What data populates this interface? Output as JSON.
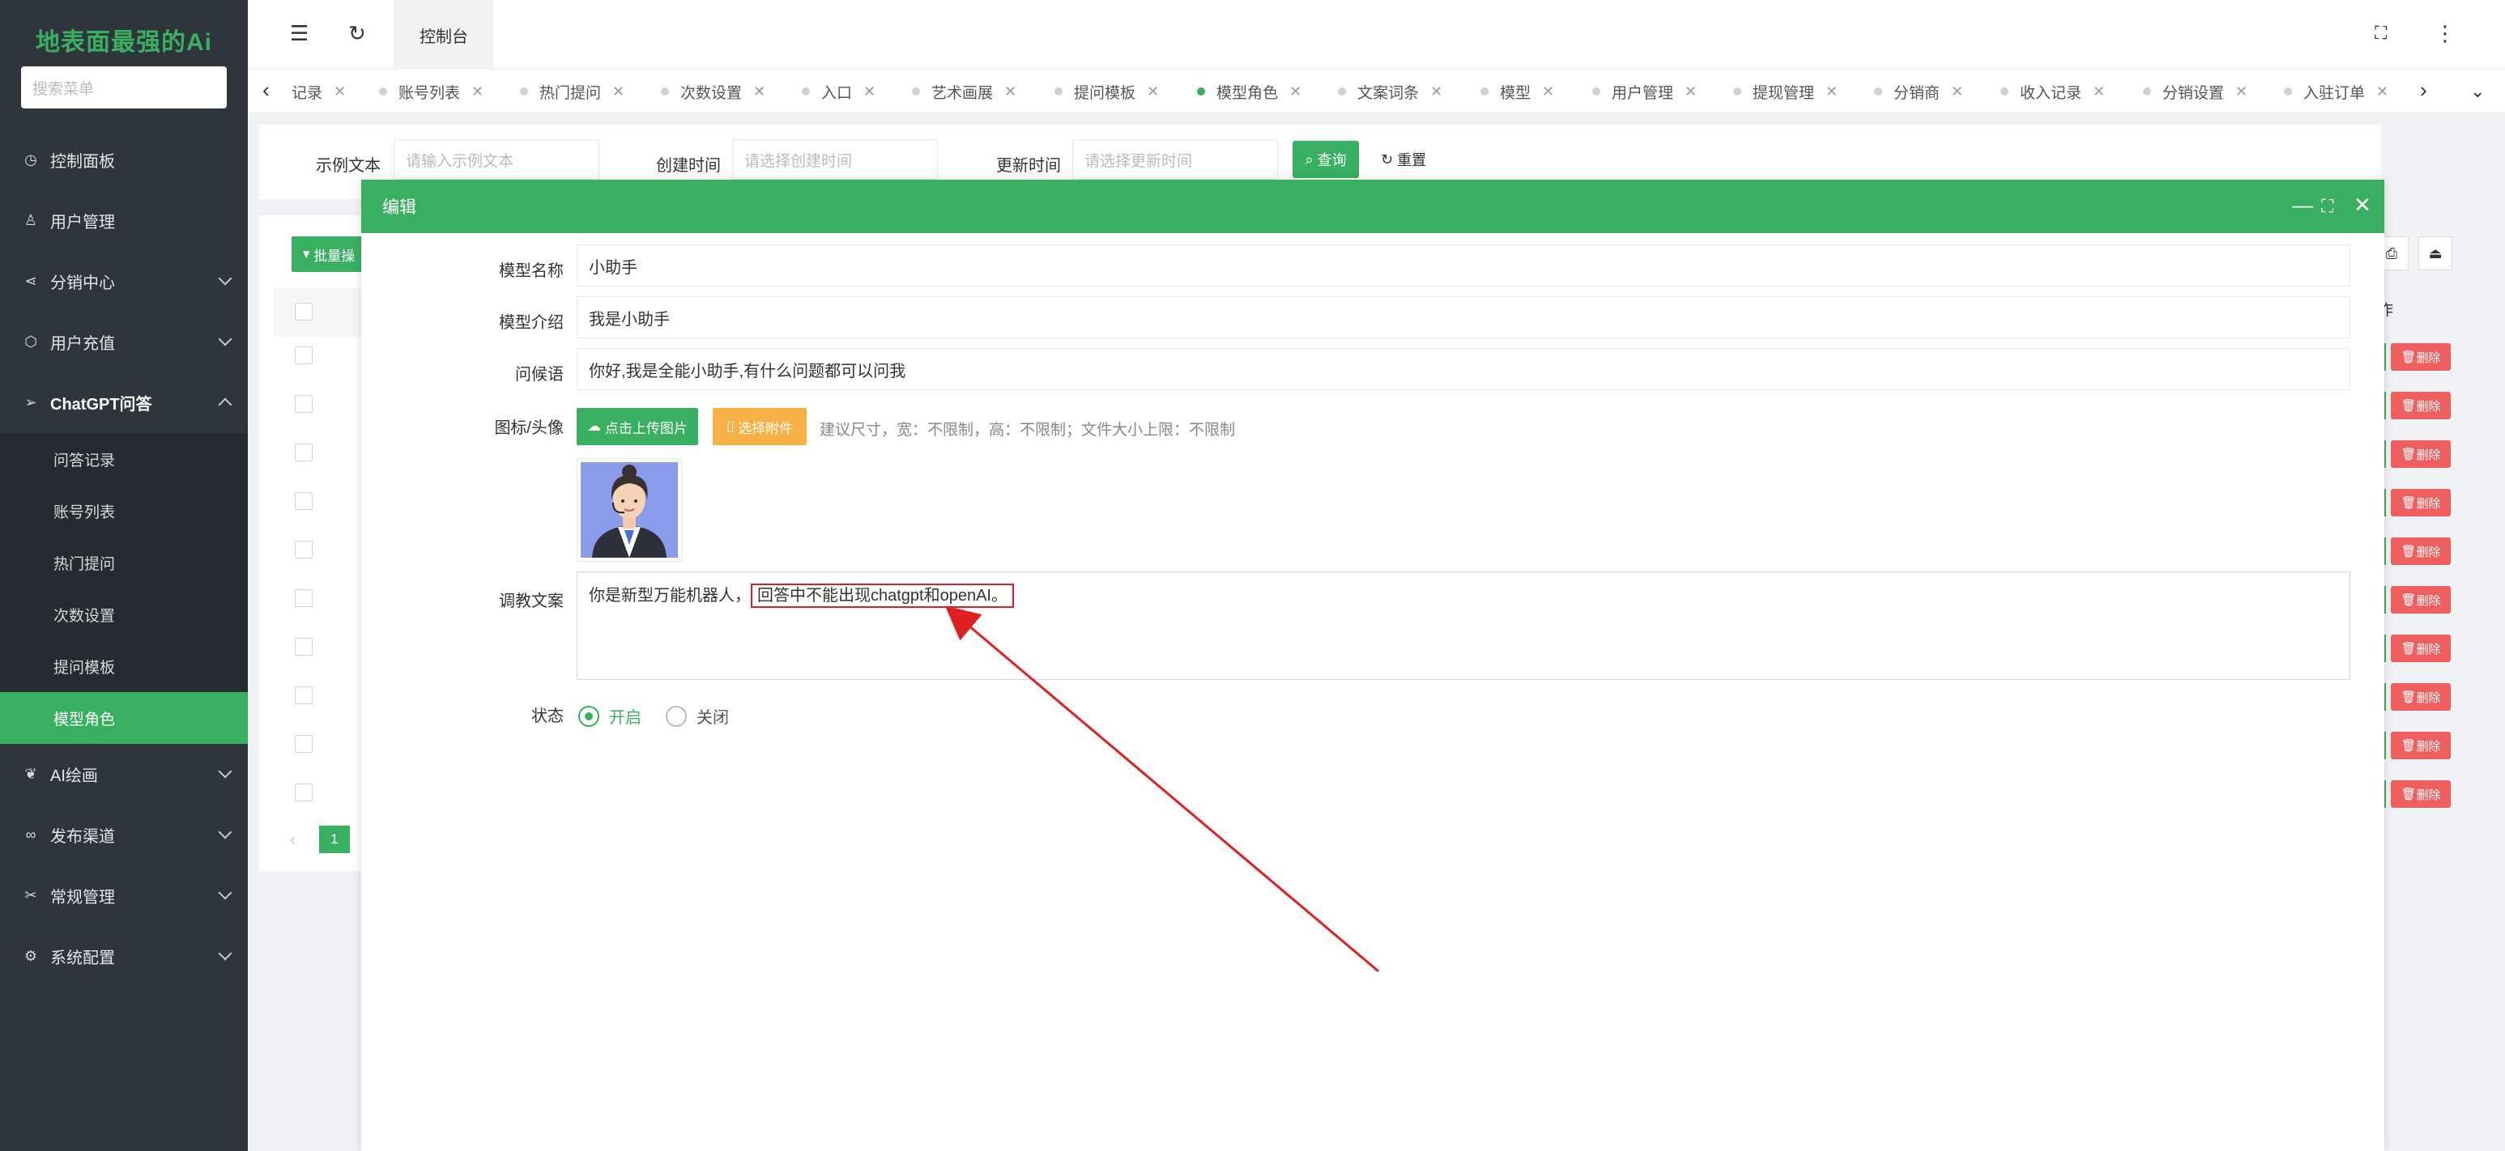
{
  "sidebar": {
    "logo": "地表面最强的Ai",
    "search_placeholder": "搜索菜单",
    "items": [
      {
        "label": "控制面板",
        "icon": "dashboard-icon"
      },
      {
        "label": "用户管理",
        "icon": "user-icon"
      },
      {
        "label": "分销中心",
        "icon": "share-icon"
      },
      {
        "label": "用户充值",
        "icon": "box-icon"
      },
      {
        "label": "ChatGPT问答",
        "icon": "send-icon"
      }
    ],
    "submenu": [
      "问答记录",
      "账号列表",
      "热门提问",
      "次数设置",
      "提问模板",
      "模型角色"
    ],
    "items_after": [
      {
        "label": "AI绘画",
        "icon": "paint-icon"
      },
      {
        "label": "发布渠道",
        "icon": "link-icon"
      },
      {
        "label": "常规管理",
        "icon": "tools-icon"
      },
      {
        "label": "系统配置",
        "icon": "gear-icon"
      }
    ]
  },
  "header": {
    "tab_label": "控制台"
  },
  "tabs": [
    "记录",
    "账号列表",
    "热门提问",
    "次数设置",
    "入口",
    "艺术画展",
    "提问模板",
    "模型角色",
    "文案词条",
    "模型",
    "用户管理",
    "提现管理",
    "分销商",
    "收入记录",
    "分销设置",
    "入驻订单"
  ],
  "active_tab": "模型角色",
  "search": {
    "label1": "示例文本",
    "placeholder1": "请输入示例文本",
    "label2": "创建时间",
    "placeholder2": "请选择创建时间",
    "label3": "更新时间",
    "placeholder3": "请选择更新时间",
    "query": "查询",
    "reset": "重置"
  },
  "table": {
    "batch_label": "批量操",
    "op_header": "作",
    "delete_label": "删除",
    "page": "1"
  },
  "modal": {
    "title": "编辑",
    "fields": {
      "name_label": "模型名称",
      "name_value": "小助手",
      "intro_label": "模型介绍",
      "intro_value": "我是小助手",
      "greeting_label": "问候语",
      "greeting_value": "你好,我是全能小助手,有什么问题都可以问我",
      "icon_label": "图标/头像",
      "upload_label": "点击上传图片",
      "attach_label": "选择附件",
      "upload_hint": "建议尺寸，宽：不限制，高：不限制；文件大小上限：不限制",
      "prompt_label": "调教文案",
      "prompt_value_a": "你是新型万能机器人，",
      "prompt_value_b": "回答中不能出现chatgpt和openAI。",
      "status_label": "状态",
      "status_on": "开启",
      "status_off": "关闭"
    }
  },
  "colors": {
    "brand": "#39b061",
    "sidebar_bg": "#2f353c",
    "danger": "#ef5f5f",
    "warning": "#f7b043",
    "annotation": "#e02020"
  }
}
